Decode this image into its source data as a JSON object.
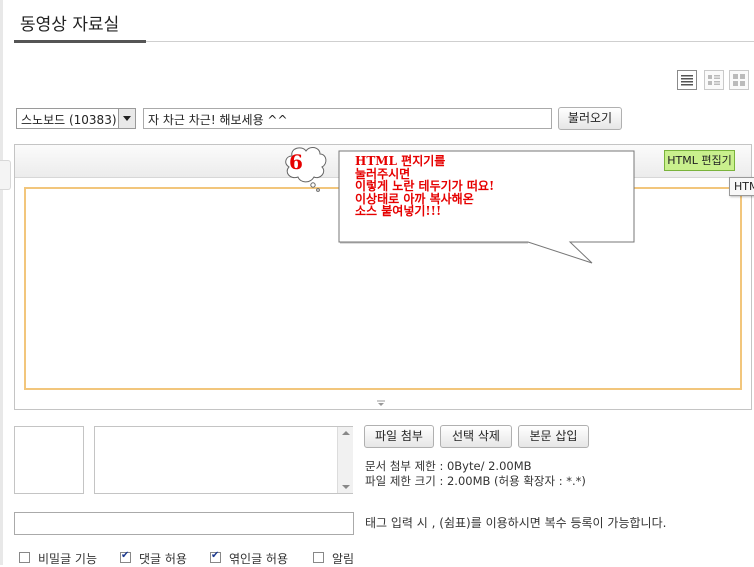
{
  "header": {
    "title": "동영상 자료실"
  },
  "view_modes": [
    "list-view-icon",
    "compact-view-icon",
    "gallery-view-icon"
  ],
  "form": {
    "category_selected": "스노보드 (10383)",
    "title_value": "자 차근 차근! 해보세용 ^^",
    "load_button": "불러오기"
  },
  "editor": {
    "html_button": "HTML 편집기",
    "tooltip": "HTM"
  },
  "annotation": {
    "number": "6",
    "lines": [
      "HTML 편지기를",
      "눌러주시면",
      "이렇게 노란 테두기가 떠요!",
      "이상태로 아까 복사해온",
      "소스 붙여넣기!!!"
    ],
    "color": "#e60000"
  },
  "attachments": {
    "buttons": {
      "attach": "파일 첨부",
      "delete": "선택 삭제",
      "insert": "본문 삽입"
    },
    "doc_limit": "문서 첨부 제한 : 0Byte/ 2.00MB",
    "file_limit": "파일 제한 크기 : 2.00MB (허용 확장자 : *.*)"
  },
  "tags": {
    "help": "태그 입력 시 , (쉼표)를 이용하시면 복수 등록이 가능합니다."
  },
  "options": [
    {
      "label": "비밀글 기능",
      "checked": false
    },
    {
      "label": "댓글 허용",
      "checked": true
    },
    {
      "label": "엮인글 허용",
      "checked": true
    },
    {
      "label": "알림",
      "checked": false
    }
  ],
  "colors": {
    "html_button_bg": "#c9f08d",
    "edit_border": "#f2c67c"
  }
}
